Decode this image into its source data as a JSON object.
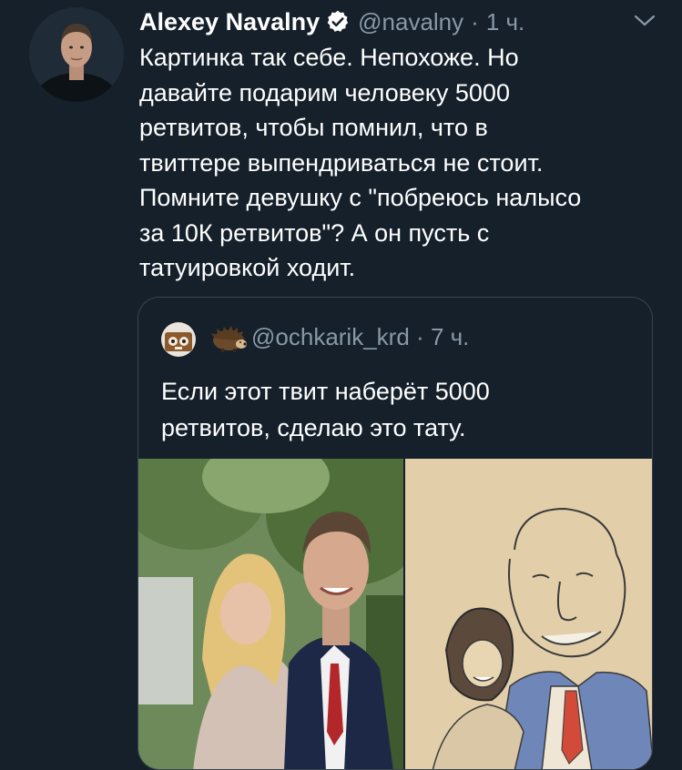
{
  "tweet": {
    "author_name": "Alexey Navalny",
    "handle": "@navalny",
    "separator": "·",
    "time": "1 ч.",
    "text": "Картинка так себе. Непохоже. Но\nдавайте подарим человеку 5000\nретвитов, чтобы помнил, что в\nтвиттере выпендриваться не стоит.\nПомните девушку с \"побреюсь налысо\nза 10К ретвитов\"? А он пусть с\nтатуировкой ходит.",
    "icons": [
      "avatar",
      "verified-badge-icon",
      "chevron-down-icon"
    ]
  },
  "quote": {
    "handle": "@ochkarik_krd",
    "separator": "·",
    "time": "7 ч.",
    "text": "Если этот твит наберёт 5000\nретвитов, сделаю это тату.",
    "icons": [
      "quote-avatar",
      "hedgehog-emoji-icon"
    ]
  },
  "colors": {
    "background": "#15202b",
    "text": "#ffffff",
    "secondary": "#8899a6",
    "accent": "#1da1f2",
    "border": "#38444d"
  }
}
